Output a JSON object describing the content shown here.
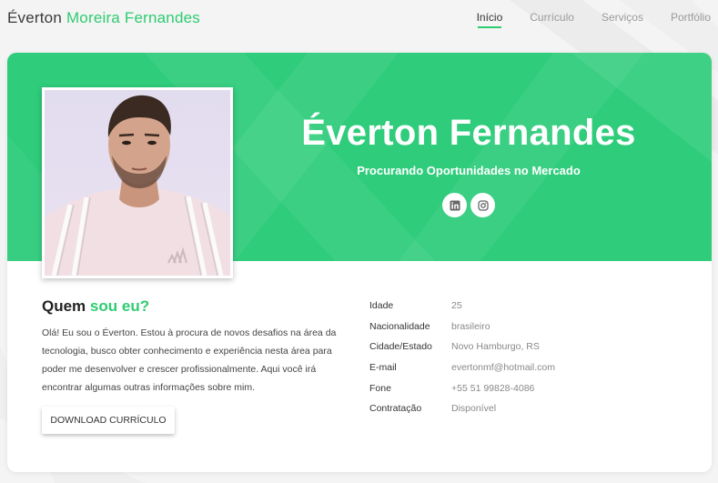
{
  "header": {
    "brand_first": "Éverton",
    "brand_rest": "Moreira Fernandes",
    "nav": [
      {
        "label": "Início",
        "active": true
      },
      {
        "label": "Currículo",
        "active": false
      },
      {
        "label": "Serviços",
        "active": false
      },
      {
        "label": "Portfólio",
        "active": false
      }
    ]
  },
  "hero": {
    "name": "Éverton Fernandes",
    "subtitle": "Procurando Oportunidades no Mercado",
    "socials": [
      {
        "icon": "linkedin-icon"
      },
      {
        "icon": "instagram-icon"
      }
    ]
  },
  "about": {
    "title_main": "Quem",
    "title_accent": "sou eu?",
    "text": "Olá! Eu sou o Éverton. Estou à procura de novos desafios na área da tecnologia, busco obter conhecimento e experiência nesta área para poder me desenvolver e crescer profissionalmente. Aqui você irá encontrar algumas outras informações sobre mim.",
    "download_label": "DOWNLOAD CURRÍCULO"
  },
  "info": [
    {
      "label": "Idade",
      "value": "25"
    },
    {
      "label": "Nacionalidade",
      "value": "brasileiro"
    },
    {
      "label": "Cidade/Estado",
      "value": "Novo Hamburgo, RS"
    },
    {
      "label": "E-mail",
      "value": "evertonmf@hotmail.com"
    },
    {
      "label": "Fone",
      "value": "+55 51 99828-4086"
    },
    {
      "label": "Contratação",
      "value": "Disponível"
    }
  ],
  "colors": {
    "accent": "#2ecc71",
    "hero_bg": "#2ecc7b"
  }
}
